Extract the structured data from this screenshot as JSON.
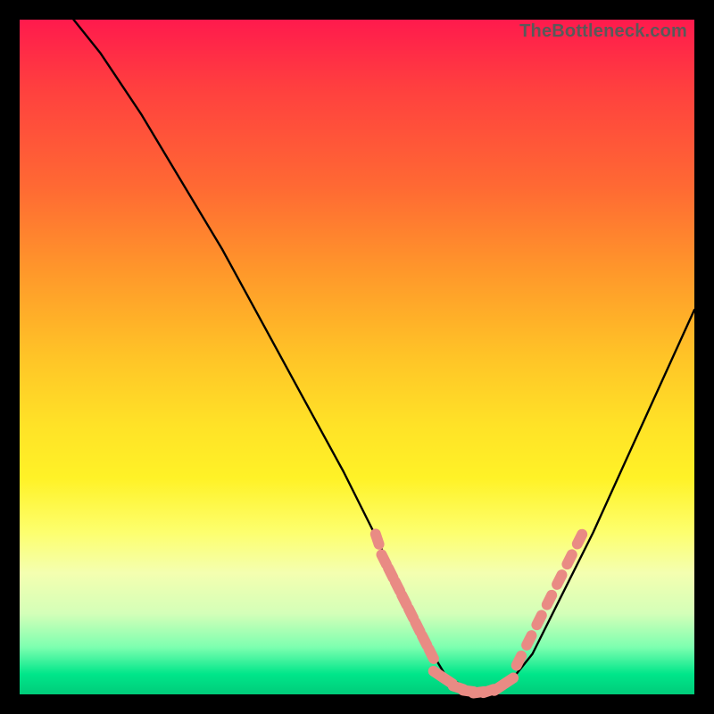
{
  "attribution": "TheBottleneck.com",
  "chart_data": {
    "type": "line",
    "title": "",
    "xlabel": "",
    "ylabel": "",
    "xlim": [
      0,
      100
    ],
    "ylim": [
      0,
      100
    ],
    "grid": false,
    "series": [
      {
        "name": "bottleneck-curve",
        "kind": "line",
        "color": "#000000",
        "x": [
          8,
          12,
          18,
          24,
          30,
          36,
          42,
          48,
          53,
          57,
          60,
          63,
          66,
          69,
          72,
          76,
          80,
          85,
          90,
          95,
          100
        ],
        "values": [
          100,
          95,
          86,
          76,
          66,
          55,
          44,
          33,
          23,
          14,
          8,
          3,
          1,
          0,
          1,
          6,
          14,
          24,
          35,
          46,
          57
        ]
      },
      {
        "name": "data-markers-left",
        "kind": "scatter",
        "marker": "pill",
        "color": "#e98b84",
        "x": [
          53,
          54,
          55,
          56,
          57,
          58,
          59,
          60,
          61
        ],
        "values": [
          23,
          20,
          18,
          16,
          14,
          12,
          10,
          8,
          6
        ]
      },
      {
        "name": "data-markers-bottom",
        "kind": "scatter",
        "marker": "pill",
        "color": "#e98b84",
        "x": [
          62,
          63.5,
          65,
          66.5,
          68,
          69.5,
          71,
          72.5
        ],
        "values": [
          3,
          2,
          1,
          0.5,
          0.3,
          0.5,
          1,
          2
        ]
      },
      {
        "name": "data-markers-right",
        "kind": "scatter",
        "marker": "pill",
        "color": "#e98b84",
        "x": [
          74,
          75.5,
          77,
          78.5,
          80,
          81.5,
          83
        ],
        "values": [
          5,
          8,
          11,
          14,
          17,
          20,
          23
        ]
      }
    ]
  }
}
